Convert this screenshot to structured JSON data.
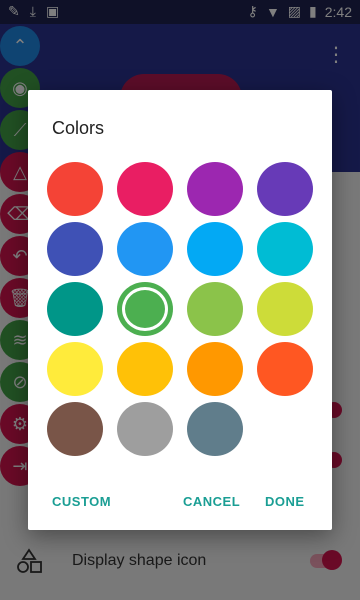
{
  "status_bar": {
    "time": "2:42"
  },
  "background": {
    "bottom_label": "Display shape icon"
  },
  "dialog": {
    "title": "Colors",
    "swatches": [
      {
        "color": "#f44336",
        "selected": false
      },
      {
        "color": "#e91e63",
        "selected": false
      },
      {
        "color": "#9c27b0",
        "selected": false
      },
      {
        "color": "#673ab7",
        "selected": false
      },
      {
        "color": "#3f51b5",
        "selected": false
      },
      {
        "color": "#2196f3",
        "selected": false
      },
      {
        "color": "#03a9f4",
        "selected": false
      },
      {
        "color": "#00bcd4",
        "selected": false
      },
      {
        "color": "#009688",
        "selected": false
      },
      {
        "color": "#4caf50",
        "selected": true
      },
      {
        "color": "#8bc34a",
        "selected": false
      },
      {
        "color": "#cddc39",
        "selected": false
      },
      {
        "color": "#ffeb3b",
        "selected": false
      },
      {
        "color": "#ffc107",
        "selected": false
      },
      {
        "color": "#ff9800",
        "selected": false
      },
      {
        "color": "#ff5722",
        "selected": false
      },
      {
        "color": "#795548",
        "selected": false
      },
      {
        "color": "#9e9e9e",
        "selected": false
      },
      {
        "color": "#607d8b",
        "selected": false
      }
    ],
    "buttons": {
      "custom": "CUSTOM",
      "cancel": "CANCEL",
      "done": "DONE"
    }
  }
}
